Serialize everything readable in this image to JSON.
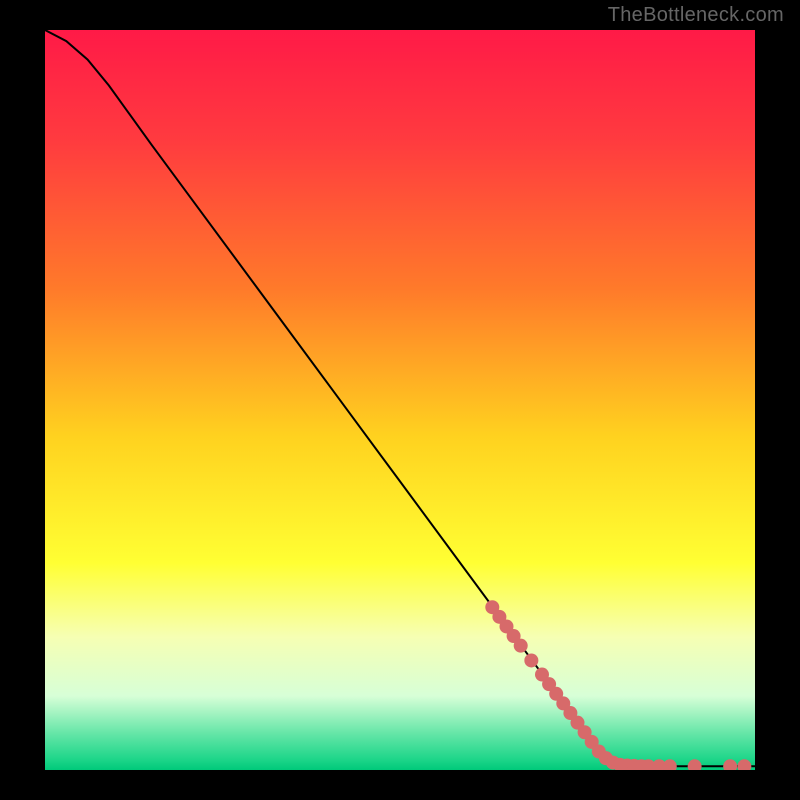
{
  "watermark": "TheBottleneck.com",
  "chart_data": {
    "type": "line",
    "title": "",
    "xlabel": "",
    "ylabel": "",
    "xlim": [
      0,
      100
    ],
    "ylim": [
      0,
      100
    ],
    "gradient_stops": [
      {
        "offset": 0.0,
        "color": "#ff1a47"
      },
      {
        "offset": 0.15,
        "color": "#ff3b3f"
      },
      {
        "offset": 0.35,
        "color": "#ff7a2a"
      },
      {
        "offset": 0.55,
        "color": "#ffd21f"
      },
      {
        "offset": 0.72,
        "color": "#ffff33"
      },
      {
        "offset": 0.82,
        "color": "#f6ffb3"
      },
      {
        "offset": 0.9,
        "color": "#d7ffd7"
      },
      {
        "offset": 0.95,
        "color": "#66e6a8"
      },
      {
        "offset": 0.985,
        "color": "#1fd68a"
      },
      {
        "offset": 1.0,
        "color": "#00c97a"
      }
    ],
    "series": [
      {
        "name": "curve",
        "kind": "line",
        "color": "#000000",
        "points": [
          {
            "x": 0.0,
            "y": 100.0
          },
          {
            "x": 3.0,
            "y": 98.5
          },
          {
            "x": 6.0,
            "y": 96.0
          },
          {
            "x": 9.0,
            "y": 92.5
          },
          {
            "x": 12.0,
            "y": 88.5
          },
          {
            "x": 15.0,
            "y": 84.5
          },
          {
            "x": 20.0,
            "y": 78.0
          },
          {
            "x": 30.0,
            "y": 65.0
          },
          {
            "x": 40.0,
            "y": 52.0
          },
          {
            "x": 50.0,
            "y": 39.0
          },
          {
            "x": 60.0,
            "y": 26.0
          },
          {
            "x": 70.0,
            "y": 13.0
          },
          {
            "x": 78.0,
            "y": 2.5
          },
          {
            "x": 80.0,
            "y": 1.0
          },
          {
            "x": 82.0,
            "y": 0.5
          },
          {
            "x": 100.0,
            "y": 0.5
          }
        ]
      },
      {
        "name": "highlight-dots",
        "kind": "scatter",
        "color": "#d76a6a",
        "radius": 7,
        "points": [
          {
            "x": 63.0,
            "y": 22.0
          },
          {
            "x": 64.0,
            "y": 20.7
          },
          {
            "x": 65.0,
            "y": 19.4
          },
          {
            "x": 66.0,
            "y": 18.1
          },
          {
            "x": 67.0,
            "y": 16.8
          },
          {
            "x": 68.5,
            "y": 14.8
          },
          {
            "x": 70.0,
            "y": 12.9
          },
          {
            "x": 71.0,
            "y": 11.6
          },
          {
            "x": 72.0,
            "y": 10.3
          },
          {
            "x": 73.0,
            "y": 9.0
          },
          {
            "x": 74.0,
            "y": 7.7
          },
          {
            "x": 75.0,
            "y": 6.4
          },
          {
            "x": 76.0,
            "y": 5.1
          },
          {
            "x": 77.0,
            "y": 3.8
          },
          {
            "x": 78.0,
            "y": 2.5
          },
          {
            "x": 79.0,
            "y": 1.6
          },
          {
            "x": 80.0,
            "y": 1.0
          },
          {
            "x": 81.0,
            "y": 0.7
          },
          {
            "x": 82.0,
            "y": 0.6
          },
          {
            "x": 83.0,
            "y": 0.55
          },
          {
            "x": 84.0,
            "y": 0.5
          },
          {
            "x": 85.0,
            "y": 0.5
          },
          {
            "x": 86.5,
            "y": 0.5
          },
          {
            "x": 88.0,
            "y": 0.5
          },
          {
            "x": 91.5,
            "y": 0.5
          },
          {
            "x": 96.5,
            "y": 0.5
          },
          {
            "x": 98.5,
            "y": 0.5
          }
        ]
      }
    ]
  }
}
